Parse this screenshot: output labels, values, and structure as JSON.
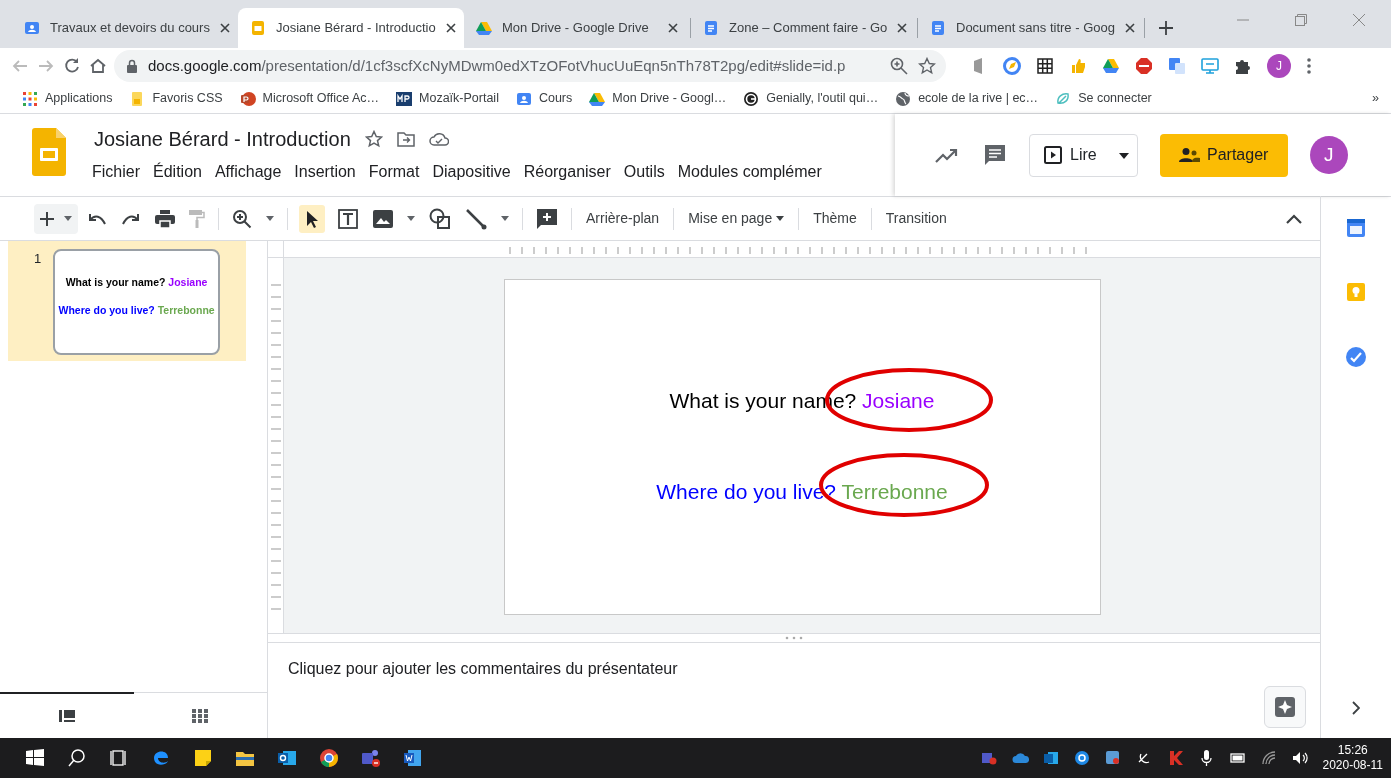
{
  "browser": {
    "tabs": [
      {
        "title": "Travaux et devoirs du cours",
        "kind": "classroom",
        "selected": false
      },
      {
        "title": "Josiane Bérard - Introductio",
        "kind": "slides",
        "selected": true
      },
      {
        "title": "Mon Drive - Google Drive",
        "kind": "drive",
        "selected": false
      },
      {
        "title": "Zone – Comment faire - Go",
        "kind": "docs",
        "selected": false
      },
      {
        "title": "Document sans titre - Goog",
        "kind": "docs",
        "selected": false
      }
    ],
    "url_host": "docs.google.com",
    "url_path": "/presentation/d/1cf3scfXcNyMDwm0edXTzOFotVhucUuEqn5nTh78T2pg/edit#slide=id.p",
    "profile_initial": "J",
    "bookmarks": [
      {
        "label": "Applications",
        "kind": "apps"
      },
      {
        "label": "Favoris CSS",
        "kind": "folder"
      },
      {
        "label": "Microsoft Office Ac…",
        "kind": "office"
      },
      {
        "label": "Mozaïk-Portail",
        "kind": "mp"
      },
      {
        "label": "Cours",
        "kind": "classroom"
      },
      {
        "label": "Mon Drive - Googl…",
        "kind": "drive"
      },
      {
        "label": "Genially, l'outil qui…",
        "kind": "ring"
      },
      {
        "label": "ecole de la rive | ec…",
        "kind": "globe"
      },
      {
        "label": "Se connecter",
        "kind": "leaf"
      }
    ],
    "bookmarks_more": "»"
  },
  "document": {
    "title": "Josiane Bérard - Introduction",
    "menu": [
      "Fichier",
      "Édition",
      "Affichage",
      "Insertion",
      "Format",
      "Diapositive",
      "Réorganiser",
      "Outils",
      "Modules complémer"
    ],
    "play_label": "Lire",
    "share_label": "Partager",
    "avatar": "J"
  },
  "toolbar": {
    "buttons": [
      {
        "label": "Arrière-plan",
        "dropdown": false
      },
      {
        "label": "Mise en page",
        "dropdown": true
      },
      {
        "label": "Thème",
        "dropdown": false
      },
      {
        "label": "Transition",
        "dropdown": false
      }
    ]
  },
  "filmstrip": {
    "slides": [
      {
        "number": "1",
        "selected": true,
        "lines": [
          {
            "parts": [
              {
                "text": "What is your name? ",
                "color": "#000000"
              },
              {
                "text": "Josiane",
                "color": "#9900ff"
              }
            ]
          },
          {
            "parts": [
              {
                "text": "Where do you live? ",
                "color": "#0000ff"
              },
              {
                "text": "Terrebonne",
                "color": "#6aa84f"
              }
            ]
          }
        ]
      }
    ]
  },
  "slide": {
    "lines": [
      {
        "parts": [
          {
            "text": "What is your name? ",
            "color": "#000000"
          },
          {
            "text": "Josiane",
            "color": "#9900ff"
          }
        ]
      },
      {
        "parts": [
          {
            "text": "Where do you live? ",
            "color": "#0000ff"
          },
          {
            "text": "Terrebonne",
            "color": "#6aa84f"
          }
        ]
      }
    ]
  },
  "notes": {
    "placeholder": "Cliquez pour ajouter les commentaires du présentateur"
  },
  "taskbar": {
    "time": "15:26",
    "date": "2020-08-11"
  }
}
